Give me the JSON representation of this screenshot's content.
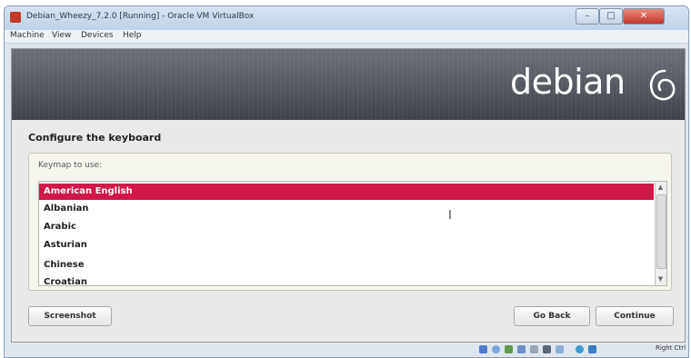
{
  "window": {
    "title": "Debian_Wheezy_7.2.0 [Running] - Oracle VM VirtualBox",
    "minimize_icon": "minimize-icon",
    "maximize_icon": "maximize-icon",
    "close_icon": "close-icon"
  },
  "menubar": {
    "items": [
      "Machine",
      "View",
      "Devices",
      "Help"
    ]
  },
  "banner": {
    "logo_text": "debian",
    "logo_icon": "debian-swirl-icon"
  },
  "installer": {
    "heading": "Configure the keyboard",
    "keymap_label": "Keymap to use:",
    "options": [
      "American English",
      "Albanian",
      "Arabic",
      "Asturian",
      "Chinese",
      "Croatian"
    ],
    "selected_index": 0
  },
  "buttons": {
    "screenshot": "Screenshot",
    "go_back": "Go Back",
    "continue": "Continue"
  },
  "statusbar": {
    "host_key": "Right Ctrl"
  },
  "colors": {
    "selection": "#d2174a",
    "banner": "#4f535b"
  }
}
